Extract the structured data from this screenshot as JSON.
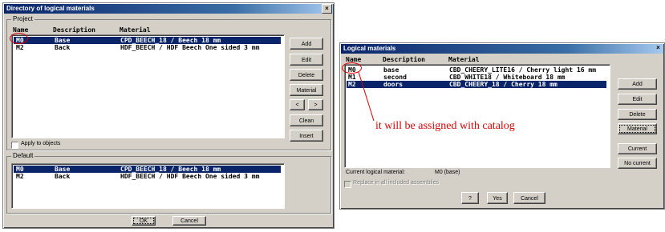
{
  "left_dialog": {
    "title": "Directory of logical materials",
    "project_group": "Project",
    "columns": [
      "Name",
      "Description",
      "Material"
    ],
    "project_rows": [
      {
        "name": "M0",
        "description": "Base",
        "material": "CPD_BEECH_18 / Beech 18 mm",
        "selected": true
      },
      {
        "name": "M2",
        "description": "Back",
        "material": "HDF_BEECH / HDF Beech One sided 3 mm",
        "selected": false
      }
    ],
    "buttons": {
      "add": "Add",
      "edit": "Edit",
      "delete": "Delete",
      "material": "Material",
      "prev": "<",
      "next": ">",
      "clean": "Clean",
      "insert": "Insert"
    },
    "apply_to_objects": "Apply to objects",
    "default_group": "Default",
    "default_rows": [
      {
        "name": "M0",
        "description": "Base",
        "material": "CPD_BEECH_18 / Beech 18 mm",
        "selected": true
      },
      {
        "name": "M2",
        "description": "Back",
        "material": "HDF_BEECH / HDF Beech One sided 3 mm",
        "selected": false
      }
    ],
    "ok": "OK",
    "cancel": "Cancel"
  },
  "right_dialog": {
    "title": "Logical materials",
    "columns": [
      "Name",
      "Description",
      "Material"
    ],
    "rows": [
      {
        "name": "M0",
        "description": "base",
        "material": "CBD_CHEERY_LITE16 / Cherry light 16 mm",
        "selected": false
      },
      {
        "name": "M1",
        "description": "second",
        "material": "CBD_WHITE18 / Whiteboard 18 mm",
        "selected": false
      },
      {
        "name": "M2",
        "description": "doors",
        "material": "CBD_CHEERY_18 / Cherry 18 mm",
        "selected": true
      }
    ],
    "buttons": {
      "add": "Add",
      "edit": "Edit",
      "delete": "Delete",
      "material": "Material",
      "current": "Current",
      "no_current": "No current"
    },
    "current_label": "Current logical material:",
    "current_value": "M0 (base)",
    "replace_label": "Replace in all included assemblies",
    "help": "?",
    "yes": "Yes",
    "cancel": "Cancel"
  },
  "annotation": {
    "text": "it will be assigned with catalog",
    "color": "#e00000"
  }
}
